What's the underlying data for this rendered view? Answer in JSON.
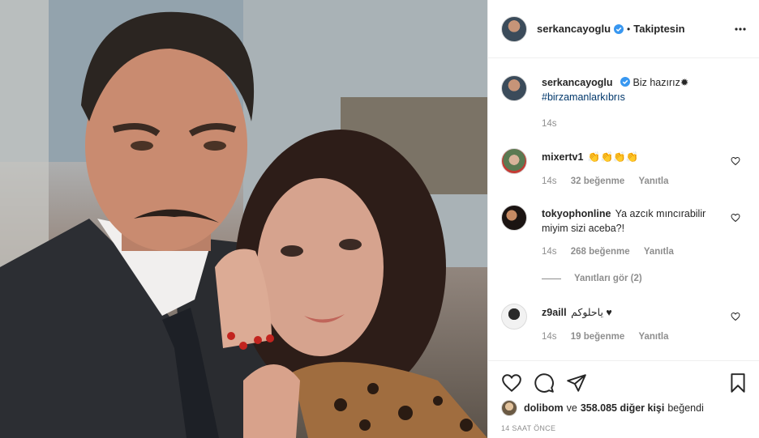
{
  "post": {
    "username": "serkancayoglu",
    "follow_status": "Takiptesin",
    "dot": "•",
    "caption": {
      "username": "serkancayoglu",
      "text": "Biz hazırız✹",
      "hashtag": "#birzamanlarkıbrıs",
      "time": "14s"
    },
    "comments": [
      {
        "username": "mixertv1",
        "text": "👏👏👏👏",
        "time": "14s",
        "likes": "32 beğenme",
        "reply": "Yanıtla"
      },
      {
        "username": "tokyophonline",
        "text": "Ya azcık mıncırabilir miyim sizi aceba?!",
        "time": "14s",
        "likes": "268 beğenme",
        "reply": "Yanıtla",
        "view_replies": "Yanıtları gör (2)"
      },
      {
        "username": "z9aill",
        "text": "ياحلوكم ♥",
        "time": "14s",
        "likes": "19 beğenme",
        "reply": "Yanıtla"
      }
    ],
    "likes": {
      "first_user": "dolibom",
      "connector": "ve",
      "others": "358.085 diğer kişi",
      "suffix": "beğendi"
    },
    "timestamp": "14 SAAT ÖNCE"
  },
  "icons": {
    "header_avatar": "profile-avatar",
    "verified": "verified-badge-icon",
    "more": "more-options-icon",
    "like": "heart-outline-icon",
    "comment": "comment-bubble-icon",
    "share": "paper-plane-icon",
    "save": "bookmark-icon"
  },
  "colors": {
    "verified_blue": "#3897f0",
    "hashtag_blue": "#00376b",
    "text": "#262626",
    "muted": "#8e8e8e",
    "border": "#efefef"
  }
}
